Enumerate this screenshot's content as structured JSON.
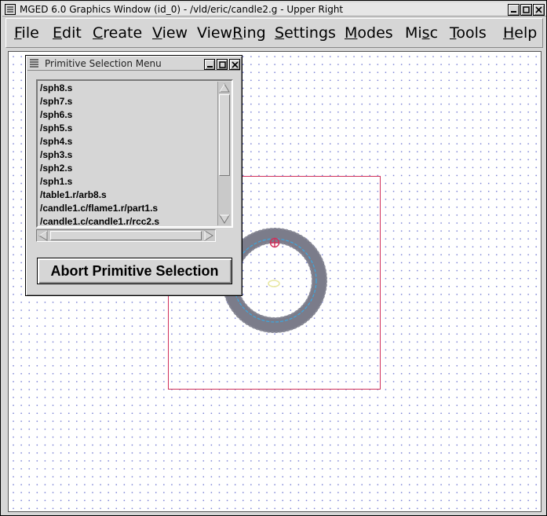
{
  "window": {
    "title": "MGED 6.0 Graphics Window (id_0) - /vld/eric/candle2.g - Upper Right",
    "sys_icon": "lines-menu-icon",
    "buttons": [
      "minimize-icon",
      "maximize-icon",
      "close-icon"
    ]
  },
  "menubar": {
    "items": [
      {
        "pre": "",
        "mn": "F",
        "post": "ile"
      },
      {
        "pre": "",
        "mn": "E",
        "post": "dit"
      },
      {
        "pre": "",
        "mn": "C",
        "post": "reate"
      },
      {
        "pre": "",
        "mn": "V",
        "post": "iew"
      },
      {
        "pre": "View",
        "mn": "R",
        "post": "ing"
      },
      {
        "pre": "",
        "mn": "S",
        "post": "ettings"
      },
      {
        "pre": "",
        "mn": "M",
        "post": "odes"
      },
      {
        "pre": "Mi",
        "mn": "s",
        "post": "c"
      },
      {
        "pre": "",
        "mn": "T",
        "post": "ools"
      },
      {
        "pre": "",
        "mn": "H",
        "post": "elp"
      }
    ]
  },
  "popup": {
    "title": "Primitive Selection Menu",
    "items": [
      "/sph8.s",
      "/sph7.s",
      "/sph6.s",
      "/sph5.s",
      "/sph4.s",
      "/sph3.s",
      "/sph2.s",
      "/sph1.s",
      "/table1.r/arb8.s",
      "/candle1.c/flame1.r/part1.s",
      "/candle1.c/candle1.r/rcc2.s"
    ],
    "abort_label": "Abort Primitive Selection"
  },
  "colors": {
    "grid_dot": "#7d84d6",
    "view_box": "#d0305a",
    "torus": "#7b7c8a",
    "highlight": "#3ba7e0",
    "center_marker": "#d0305a"
  }
}
